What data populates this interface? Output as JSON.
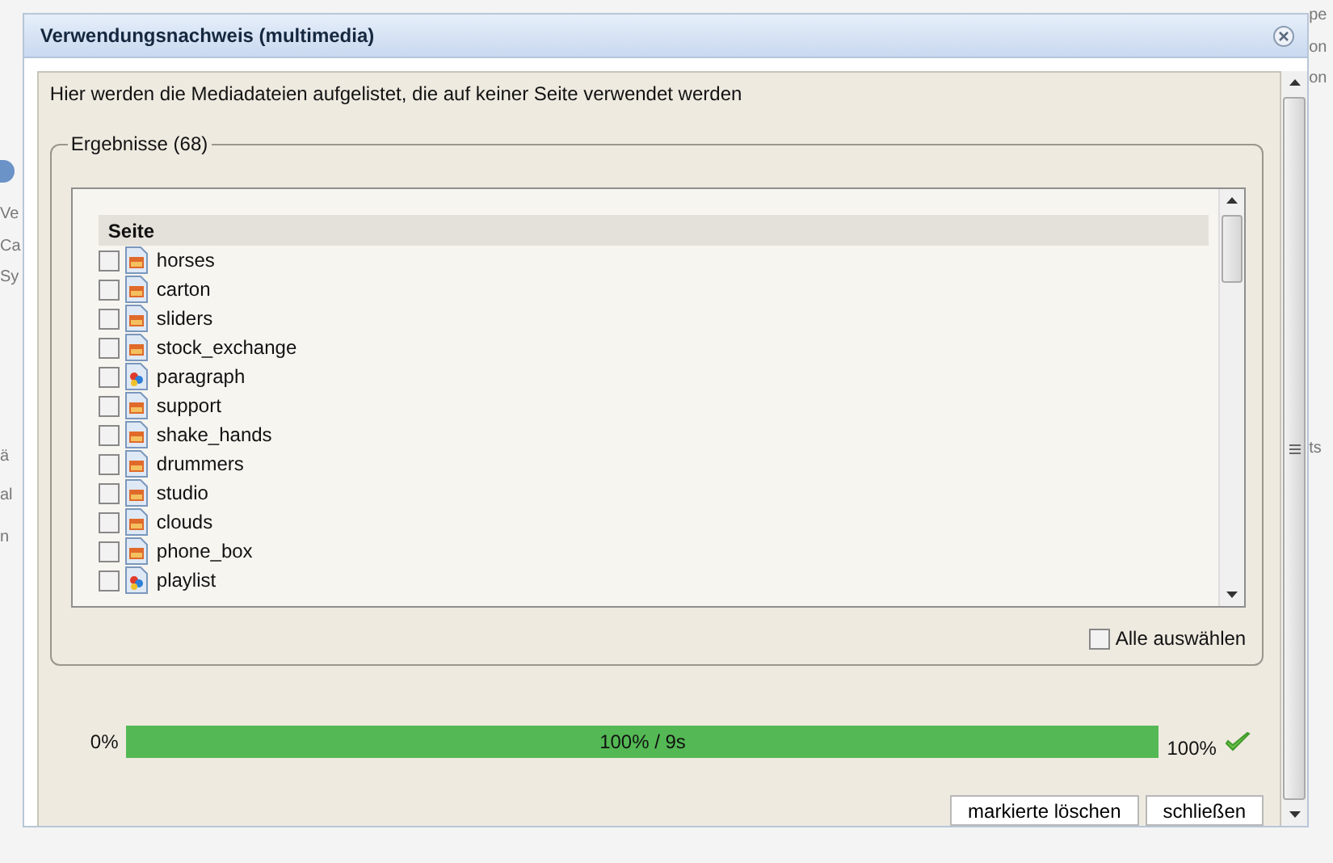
{
  "background": {
    "left": [
      "Ve",
      "Ca",
      "Sy",
      "ä",
      "al",
      "n"
    ],
    "right": [
      "pe",
      "on",
      "on",
      "ts"
    ]
  },
  "dialog": {
    "title": "Verwendungsnachweis (multimedia)",
    "intro": "Hier werden die Mediadateien aufgelistet, die auf keiner Seite verwendet werden",
    "results": {
      "legend": "Ergebnisse (68)",
      "column": "Seite",
      "items": [
        {
          "name": "horses",
          "kind": "image",
          "checked": false
        },
        {
          "name": "carton",
          "kind": "image",
          "checked": false
        },
        {
          "name": "sliders",
          "kind": "image",
          "checked": false
        },
        {
          "name": "stock_exchange",
          "kind": "image",
          "checked": false
        },
        {
          "name": "paragraph",
          "kind": "media",
          "checked": false
        },
        {
          "name": "support",
          "kind": "image",
          "checked": false
        },
        {
          "name": "shake_hands",
          "kind": "image",
          "checked": false
        },
        {
          "name": "drummers",
          "kind": "image",
          "checked": false
        },
        {
          "name": "studio",
          "kind": "image",
          "checked": false
        },
        {
          "name": "clouds",
          "kind": "image",
          "checked": false
        },
        {
          "name": "phone_box",
          "kind": "image",
          "checked": false
        },
        {
          "name": "playlist",
          "kind": "media",
          "checked": false
        }
      ]
    },
    "select_all": {
      "label": "Alle auswählen",
      "checked": false
    },
    "progress": {
      "start": "0%",
      "level": 1,
      "reading": "100% / 9s",
      "end": "100%",
      "done": true
    },
    "buttons": [
      "markierte löschen",
      "schließen"
    ]
  }
}
